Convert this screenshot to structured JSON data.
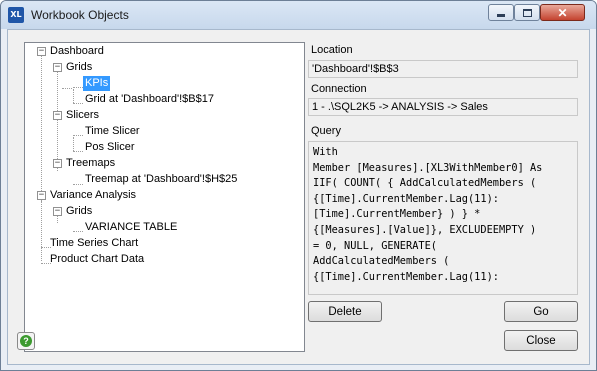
{
  "window": {
    "title": "Workbook Objects",
    "app_icon": "XL"
  },
  "caption_buttons": {
    "close": "✕"
  },
  "tree": {
    "dashboard": "Dashboard",
    "grids": "Grids",
    "kpis": "KPIs",
    "grid_at": "Grid at 'Dashboard'!$B$17",
    "slicers": "Slicers",
    "time_slicer": "Time Slicer",
    "pos_slicer": "Pos Slicer",
    "treemaps": "Treemaps",
    "treemap_at": "Treemap at 'Dashboard'!$H$25",
    "variance_analysis": "Variance Analysis",
    "va_grids": "Grids",
    "variance_table": "VARIANCE TABLE",
    "time_series_chart": "Time Series Chart",
    "product_chart_data": "Product Chart Data",
    "collapse_glyph": "−"
  },
  "details": {
    "location_label": "Location",
    "location_value": "'Dashboard'!$B$3",
    "connection_label": "Connection",
    "connection_value": "1 - .\\SQL2K5 -> ANALYSIS -> Sales",
    "query_label": "Query",
    "query_text": "With\nMember [Measures].[XL3WithMember0] As\nIIF( COUNT( { AddCalculatedMembers (\n{[Time].CurrentMember.Lag(11):\n[Time].CurrentMember} ) } *\n{[Measures].[Value]}, EXCLUDEEMPTY )\n= 0, NULL, GENERATE(\nAddCalculatedMembers (\n{[Time].CurrentMember.Lag(11):"
  },
  "buttons": {
    "delete": "Delete",
    "go": "Go",
    "close": "Close"
  },
  "help": {
    "glyph": "?"
  }
}
